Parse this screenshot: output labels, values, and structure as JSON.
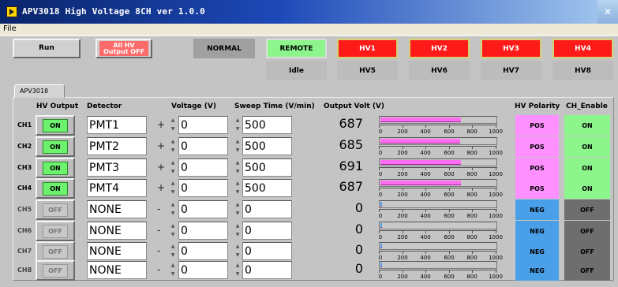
{
  "window": {
    "title": "APV3018 High Voltage 8CH  ver 1.0.0",
    "close_glyph": "✕"
  },
  "menu": {
    "file": "File"
  },
  "top": {
    "run": "Run",
    "all_off": "All HV\nOutput OFF",
    "mode": "NORMAL",
    "remote": "REMOTE",
    "status": "Idle",
    "hv": [
      "HV1",
      "HV2",
      "HV3",
      "HV4",
      "HV5",
      "HV6",
      "HV7",
      "HV8"
    ]
  },
  "tab": {
    "label": "APV3018"
  },
  "headers": {
    "hv_output": "HV Output",
    "detector": "Detector",
    "voltage": "Voltage (V)",
    "sweep": "Sweep Time (V/min)",
    "output_volt": "Output Volt (V)",
    "polarity": "HV Polarity",
    "ch_enable": "CH_Enable"
  },
  "scale_labels": [
    "0",
    "200",
    "400",
    "600",
    "800",
    "1000"
  ],
  "colors": {
    "led_on": "#6cf26c",
    "pos": "#ff90ff",
    "neg": "#4aa0e8",
    "en_on": "#8cf58c",
    "en_off": "#6e6e6e",
    "hv_red": "#ff0000"
  },
  "channels": [
    {
      "ch": "CH1",
      "out": "ON",
      "det": "PMT1",
      "sign": "+",
      "volt": "0",
      "sweep": "500",
      "outv": "687",
      "bar_frac": 0.687,
      "pol": "POS",
      "en": "ON"
    },
    {
      "ch": "CH2",
      "out": "ON",
      "det": "PMT2",
      "sign": "+",
      "volt": "0",
      "sweep": "500",
      "outv": "685",
      "bar_frac": 0.685,
      "pol": "POS",
      "en": "ON"
    },
    {
      "ch": "CH3",
      "out": "ON",
      "det": "PMT3",
      "sign": "+",
      "volt": "0",
      "sweep": "500",
      "outv": "691",
      "bar_frac": 0.691,
      "pol": "POS",
      "en": "ON"
    },
    {
      "ch": "CH4",
      "out": "ON",
      "det": "PMT4",
      "sign": "+",
      "volt": "0",
      "sweep": "500",
      "outv": "687",
      "bar_frac": 0.687,
      "pol": "POS",
      "en": "ON"
    },
    {
      "ch": "CH5",
      "out": "OFF",
      "det": "NONE",
      "sign": "-",
      "volt": "0",
      "sweep": "0",
      "outv": "0",
      "bar_frac": 0,
      "pol": "NEG",
      "en": "OFF"
    },
    {
      "ch": "CH6",
      "out": "OFF",
      "det": "NONE",
      "sign": "-",
      "volt": "0",
      "sweep": "0",
      "outv": "0",
      "bar_frac": 0,
      "pol": "NEG",
      "en": "OFF"
    },
    {
      "ch": "CH7",
      "out": "OFF",
      "det": "NONE",
      "sign": "-",
      "volt": "0",
      "sweep": "0",
      "outv": "0",
      "bar_frac": 0,
      "pol": "NEG",
      "en": "OFF"
    },
    {
      "ch": "CH8",
      "out": "OFF",
      "det": "NONE",
      "sign": "-",
      "volt": "0",
      "sweep": "0",
      "outv": "0",
      "bar_frac": 0,
      "pol": "NEG",
      "en": "OFF"
    }
  ]
}
